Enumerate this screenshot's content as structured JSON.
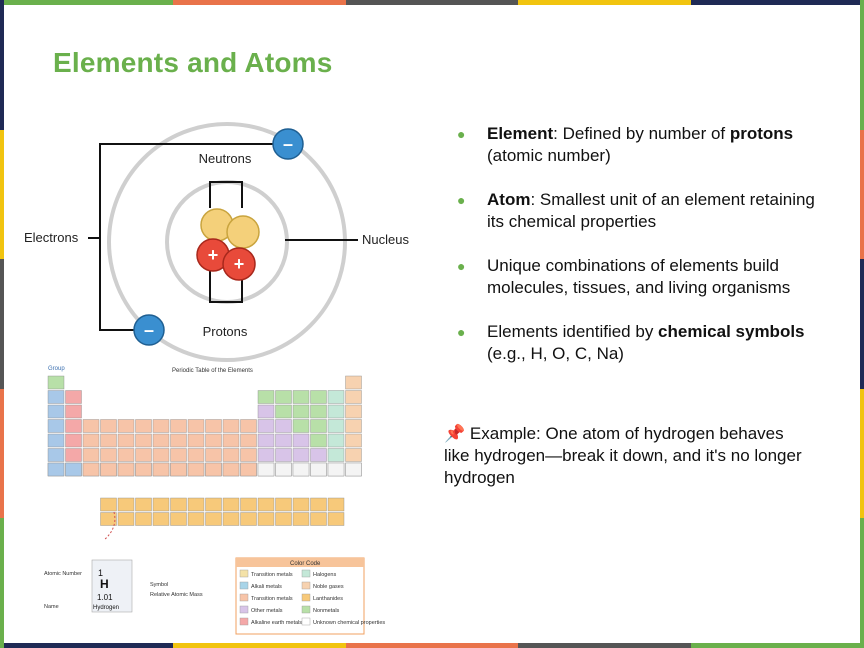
{
  "slide": {
    "title": "Elements and Atoms",
    "frame_colors": [
      "#6ab04c",
      "#e9734a",
      "#1f2a55",
      "#f1c40f",
      "#555555",
      "#6ab04c"
    ]
  },
  "atom_diagram": {
    "label_neutrons": "Neutrons",
    "label_protons": "Protons",
    "label_electrons": "Electrons",
    "label_nucleus": "Nucleus",
    "electron_symbol": "–",
    "proton_symbol": "+"
  },
  "periodic_table": {
    "title": "Periodic Table of the Elements",
    "group_label": "Group",
    "key": {
      "atomic_number": "1",
      "symbol": "H",
      "mass": "1.01",
      "name": "Hydrogen",
      "label_atomic_number": "Atomic Number",
      "label_symbol": "Symbol",
      "label_mass": "Relative Atomic Mass",
      "label_name": "Name"
    },
    "color_code": {
      "title": "Color Code",
      "items": [
        {
          "label": "Transition metals",
          "color": "#f4e2a8"
        },
        {
          "label": "Alkali metals",
          "color": "#a8d4e8"
        },
        {
          "label": "Transition metals",
          "color": "#f7c4a8"
        },
        {
          "label": "Other metals",
          "color": "#d8c4e8"
        },
        {
          "label": "Alkaline earth metals",
          "color": "#f4a8a8"
        },
        {
          "label": "Halogens",
          "color": "#c4e8d8"
        },
        {
          "label": "Noble gases",
          "color": "#f7d2b0"
        },
        {
          "label": "Lanthanides",
          "color": "#f7c97a"
        },
        {
          "label": "Nonmetals",
          "color": "#b8e0a8"
        },
        {
          "label": "Unknown chemical properties",
          "color": "#ffffff"
        }
      ]
    }
  },
  "bullets": [
    {
      "bold1": "Element",
      "text1": ": Defined by number of ",
      "bold2": "protons",
      "text2": " (atomic number)"
    },
    {
      "bold1": "Atom",
      "text1": ": Smallest unit of an element retaining its chemical properties",
      "bold2": "",
      "text2": ""
    },
    {
      "bold1": "",
      "text1": "Unique combinations of elements build molecules, tissues, and living organisms",
      "bold2": "",
      "text2": ""
    },
    {
      "bold1": "",
      "text1": "Elements identified by ",
      "bold2": "chemical symbols",
      "text2": " (e.g., H, O, C, Na)"
    }
  ],
  "bullet_symbol": "●",
  "example": {
    "pin": "📌",
    "text": " Example: One atom of hydrogen behaves like hydrogen—break it down, and it's no longer hydrogen"
  }
}
